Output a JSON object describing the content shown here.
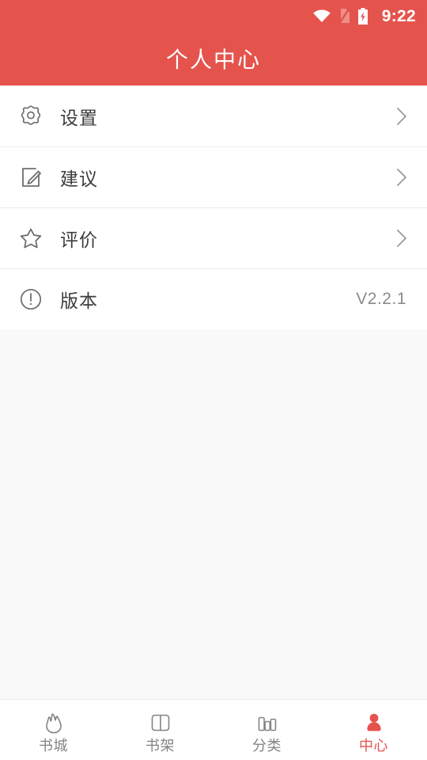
{
  "theme": {
    "accent": "#e5534d",
    "header_bg": "#e5534d",
    "page_bg": "#f9f9f9",
    "card_bg": "#ffffff",
    "divider": "#ececec",
    "text_primary": "#3c3c3c",
    "text_secondary": "#8b8b8b",
    "icon_gray": "#707070",
    "nav_inactive": "#838383"
  },
  "status_bar": {
    "time": "9:22",
    "icons": [
      "wifi-icon",
      "sim-card-off-icon",
      "battery-charging-icon"
    ]
  },
  "header": {
    "title": "个人中心"
  },
  "list": {
    "items": [
      {
        "icon": "gear-icon",
        "label": "设置",
        "value": "",
        "accessory": "chevron-right-icon"
      },
      {
        "icon": "edit-note-icon",
        "label": "建议",
        "value": "",
        "accessory": "chevron-right-icon"
      },
      {
        "icon": "star-icon",
        "label": "评价",
        "value": "",
        "accessory": "chevron-right-icon"
      },
      {
        "icon": "info-circle-icon",
        "label": "版本",
        "value": "V2.2.1",
        "accessory": ""
      }
    ]
  },
  "bottom_nav": {
    "items": [
      {
        "icon": "flame-icon",
        "label": "书城",
        "active": false
      },
      {
        "icon": "open-book-icon",
        "label": "书架",
        "active": false
      },
      {
        "icon": "bar-chart-icon",
        "label": "分类",
        "active": false
      },
      {
        "icon": "person-icon",
        "label": "中心",
        "active": true
      }
    ]
  }
}
